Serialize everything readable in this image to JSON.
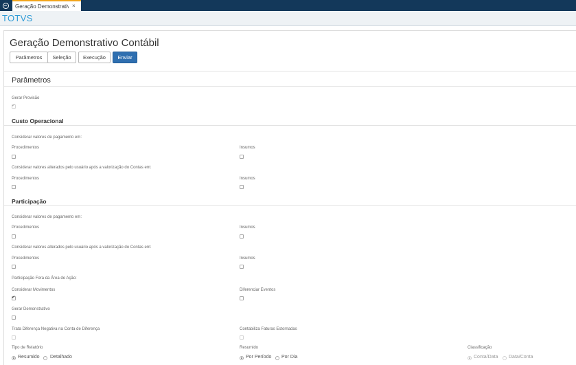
{
  "window": {
    "tab_label": "Geração Demonstrativo",
    "tab_close": "×",
    "brand": "TOTVS"
  },
  "page": {
    "title": "Geração Demonstrativo Contábil"
  },
  "toolbar": {
    "parametros": "Parâmetros",
    "selecao": "Seleção",
    "execucao": "Execução",
    "enviar": "Enviar"
  },
  "parametros": {
    "heading": "Parâmetros",
    "gerar_provisao_label": "Gerar Provisão",
    "gerar_provisao_checked": true
  },
  "custo": {
    "heading": "Custo Operacional",
    "pagamento_label": "Considerar valores de pagamento em:",
    "procedimentos_1": "Procedimentos",
    "insumos_1": "Insumos",
    "alterados_label": "Considerar valores alterados pelo usuário após a valorização do Contas em:",
    "procedimentos_2": "Procedimentos",
    "insumos_2": "Insumos"
  },
  "participacao": {
    "heading": "Participação",
    "pagamento_label": "Considerar valores de pagamento em:",
    "procedimentos_1": "Procedimentos",
    "insumos_1": "Insumos",
    "alterados_label": "Considerar valores alterados pelo usuário após a valorização do Contas em:",
    "procedimentos_2": "Procedimentos",
    "insumos_2": "Insumos",
    "fora_area_label": "Participação Fora da Área de Ação:",
    "considerar_movimentos": "Considerar Movimentos",
    "considerar_movimentos_checked": true,
    "diferenciar_eventos": "Diferenciar Eventos",
    "gerar_demonstrativo": "Gerar Demonstrativo",
    "trata_diferenca": "Trata Diferença Negativa na Conta de Diferença",
    "contabiliza_faturas": "Contabiliza Faturas Estornadas"
  },
  "relatorio": {
    "tipo_label": "Tipo de Relatório",
    "tipo_options": [
      "Resumido",
      "Detalhado"
    ],
    "tipo_selected": "Resumido",
    "resumido_label": "Resumido",
    "resumido_options": [
      "Por Período",
      "Por Dia"
    ],
    "resumido_selected": "Por Período",
    "classificacao_label": "Classificação",
    "classificacao_options": [
      "Conta/Data",
      "Data/Conta"
    ],
    "classificacao_selected": "Conta/Data"
  }
}
